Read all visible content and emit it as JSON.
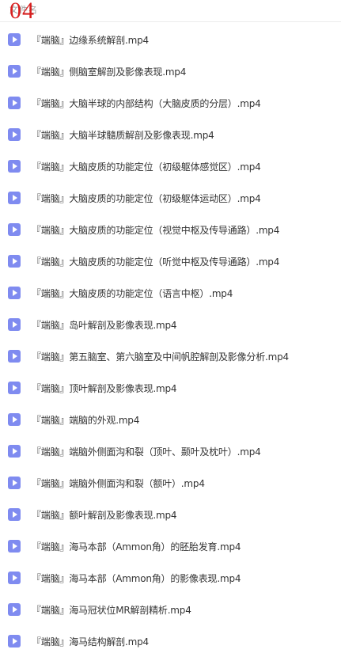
{
  "header": {
    "label": "文件名",
    "number": "04"
  },
  "files": [
    {
      "name": "『端脑』边缘系统解剖.mp4",
      "icon": "video-file-icon"
    },
    {
      "name": "『端脑』侧脑室解剖及影像表现.mp4",
      "icon": "video-file-icon"
    },
    {
      "name": "『端脑』大脑半球的内部结构（大脑皮质的分层）.mp4",
      "icon": "video-file-icon"
    },
    {
      "name": "『端脑』大脑半球髓质解剖及影像表现.mp4",
      "icon": "video-file-icon"
    },
    {
      "name": "『端脑』大脑皮质的功能定位（初级躯体感觉区）.mp4",
      "icon": "video-file-icon"
    },
    {
      "name": "『端脑』大脑皮质的功能定位（初级躯体运动区）.mp4",
      "icon": "video-file-icon"
    },
    {
      "name": "『端脑』大脑皮质的功能定位（视觉中枢及传导通路）.mp4",
      "icon": "video-file-icon"
    },
    {
      "name": "『端脑』大脑皮质的功能定位（听觉中枢及传导通路）.mp4",
      "icon": "video-file-icon"
    },
    {
      "name": "『端脑』大脑皮质的功能定位（语言中枢）.mp4",
      "icon": "video-file-icon"
    },
    {
      "name": "『端脑』岛叶解剖及影像表现.mp4",
      "icon": "video-file-icon"
    },
    {
      "name": "『端脑』第五脑室、第六脑室及中间帆腔解剖及影像分析.mp4",
      "icon": "video-file-icon"
    },
    {
      "name": "『端脑』顶叶解剖及影像表现.mp4",
      "icon": "video-file-icon"
    },
    {
      "name": "『端脑』端脑的外观.mp4",
      "icon": "video-file-icon"
    },
    {
      "name": "『端脑』端脑外侧面沟和裂（顶叶、颞叶及枕叶）.mp4",
      "icon": "video-file-icon"
    },
    {
      "name": "『端脑』端脑外侧面沟和裂（额叶）.mp4",
      "icon": "video-file-icon"
    },
    {
      "name": "『端脑』额叶解剖及影像表现.mp4",
      "icon": "video-file-icon"
    },
    {
      "name": "『端脑』海马本部（Ammon角）的胚胎发育.mp4",
      "icon": "video-file-icon"
    },
    {
      "name": "『端脑』海马本部（Ammon角）的影像表现.mp4",
      "icon": "video-file-icon"
    },
    {
      "name": "『端脑』海马冠状位MR解剖精析.mp4",
      "icon": "video-file-icon"
    },
    {
      "name": "『端脑』海马结构解剖.mp4",
      "icon": "video-file-icon"
    }
  ]
}
